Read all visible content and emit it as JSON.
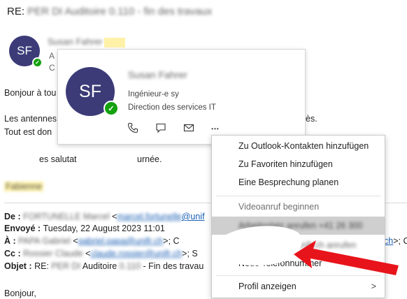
{
  "email": {
    "subject_prefix": "RE: ",
    "subject_rest": "PER DI Auditoire 0.110 - fin des travaux",
    "sender_initials": "SF",
    "sender_name": "Susan Fahrer",
    "header_line_a": "A",
    "header_line_c": "C",
    "body_greeting": "Bonjour à tou",
    "body_line1": "Les antennes",
    "body_line1_end": "ès.",
    "body_line2": "Tout est don",
    "body_closing_a": "es salutat",
    "body_closing_b": "urnée.",
    "signature": "Fabienne",
    "reply_header": {
      "de_label": "De : ",
      "de_value": "FORTUNELLE Marcel",
      "de_email": "marcel.fortunelle",
      "de_email_domain": "@unif",
      "envoye_label": "Envoyé : ",
      "envoye_value": "Tuesday, 22 August 2023 11:01",
      "a_label": "À : ",
      "a_value": "PAPA Gabriel",
      "a_email": "gabriel.papa@unifr.ch",
      "a_tail": ">; C",
      "a_link_end": "ch",
      "a_tail2": ">; CC",
      "cc_label": "Cc : ",
      "cc_value": "Rossier Claude",
      "cc_email": "claude.rossier@unifr.ch",
      "cc_tail": ">; S",
      "objet_label": "Objet : ",
      "objet_value_pre": "RE: ",
      "objet_blur": "PER DI",
      "objet_mid": " Auditoire ",
      "objet_blur2": "0.110",
      "objet_value_post": " - Fin des travau"
    },
    "bonjour": "Bonjour,"
  },
  "contact_card": {
    "initials": "SF",
    "name": "Susan Fahrer",
    "title": "Ingénieur-e sy",
    "department": "Direction des services IT",
    "actions": [
      "phone-icon",
      "chat-icon",
      "mail-icon",
      "more-icon"
    ],
    "more_glyph": "•••"
  },
  "context_menu": {
    "items": [
      {
        "label": "Zu Outlook-Kontakten hinzufügen",
        "enabled": true
      },
      {
        "label": "Zu Favoriten hinzufügen",
        "enabled": true
      },
      {
        "label": "Eine Besprechung planen",
        "enabled": true
      },
      {
        "label": "Videoanruf beginnen",
        "enabled": false
      },
      {
        "label": "Arbeitsplatz anrufen +41 26 300",
        "enabled": true,
        "hover": true
      },
      {
        "label": "susan.fahrer@unifr.ch anrufen",
        "enabled": false
      },
      {
        "label": "Neue Telefonnummer",
        "enabled": true
      },
      {
        "label": "Profil anzeigen",
        "enabled": true,
        "submenu": true
      }
    ],
    "submenu_glyph": ">"
  },
  "colors": {
    "avatar": "#3c3b78",
    "presence": "#13a10e",
    "annotation_arrow": "#e8141b",
    "link": "#1a5fb4",
    "highlight": "#fff2a8"
  }
}
